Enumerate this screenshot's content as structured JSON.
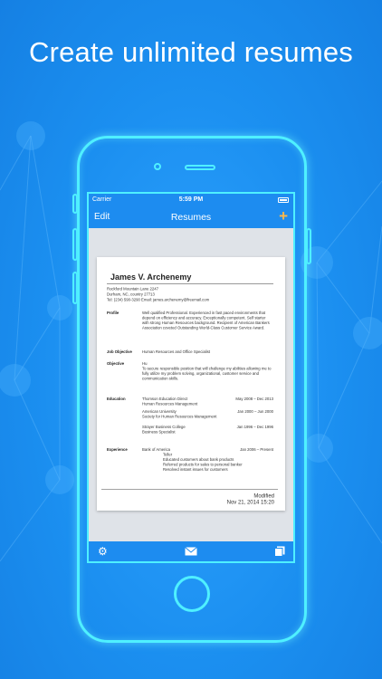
{
  "headline": "Create unlimited resumes",
  "colors": {
    "accent": "#1d8cf0",
    "outline": "#4ff0ff",
    "add": "#ffb84a"
  },
  "statusbar": {
    "carrier": "Carrier",
    "time": "5:59 PM"
  },
  "navbar": {
    "edit": "Edit",
    "title": "Resumes",
    "add_icon": "plus-icon"
  },
  "resume": {
    "name": "James V. Archenemy",
    "address": [
      "Rockford Mountain Lane 2247",
      "Durham, NC, country 27713",
      "Tel: (234) 590-3290  Email: james.archenemy@freemail.com"
    ],
    "profile_label": "Profile",
    "profile_text": "Well qualified Professional. Experienced in fast paced environments that depend on efficiency and accuracy. Exceptionally competent. Self starter with strong Human Resources background. Recipient of American Bankers Association coveted Outstanding World-Class Customer Service Award.",
    "job_objective_label": "Job Objective",
    "job_objective_text": "Human Resources and Office Specialist",
    "objective_label": "Objective",
    "objective_hu": "Hu",
    "objective_text": "To secure responsible position that will challenge my abilities allowing me to fully utilize my problem solving, organizational, customer service and communication skills.",
    "education_label": "Education",
    "education": [
      {
        "school": "Thomson Education Direct",
        "dates": "May 2008 – Dec 2013",
        "detail": "Human Resources Management"
      },
      {
        "school": "American University",
        "dates": "Jan 2000 – Jun 2000",
        "detail": "Society for Human Resources Management"
      },
      {
        "school": "Strayer Business College",
        "dates": "Jan 1996 – Dec 1996",
        "detail": "Business Specialist"
      }
    ],
    "experience_label": "Experience",
    "experience": {
      "employer": "Bank of America",
      "dates": "Jan 2006 – Present",
      "title": "Teller",
      "duties": [
        "Educated customers about bank products",
        "Referred products for sales to personal banker",
        "Resolved instant issues for customers"
      ]
    },
    "modified_label": "Modified",
    "modified_date": "Nov 21, 2014 15:20"
  },
  "toolbar": {
    "icons": [
      "gear-icon",
      "mail-icon",
      "copy-icon"
    ]
  }
}
